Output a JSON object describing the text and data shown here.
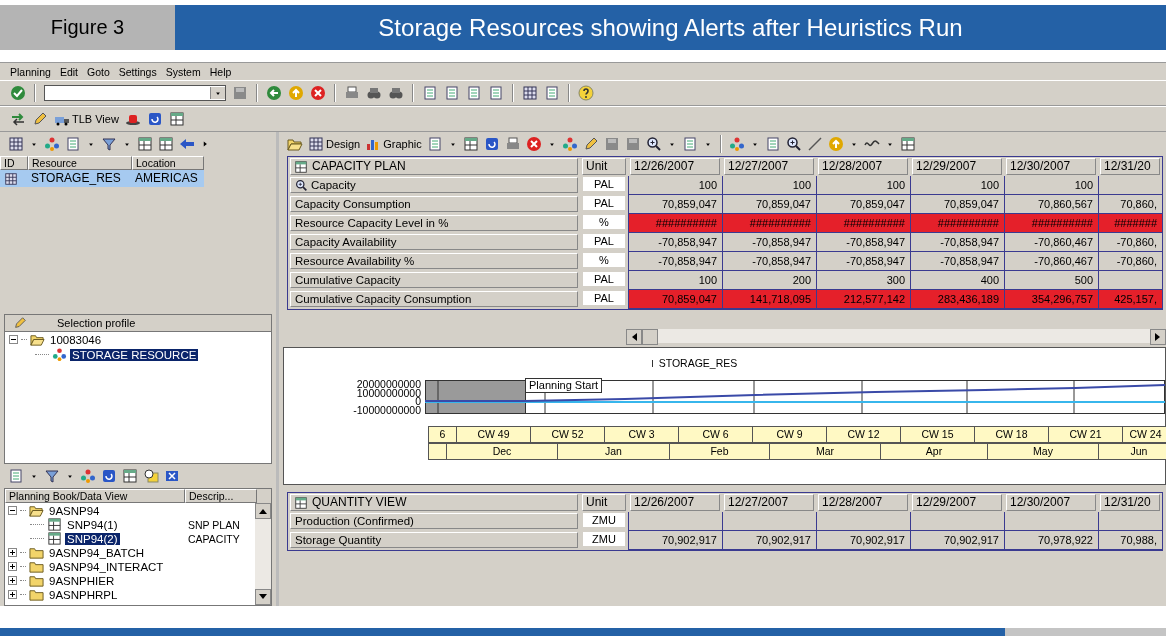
{
  "figure": {
    "label": "Figure 3",
    "title": "Storage Resources showing Alerts after Heuristics Run"
  },
  "menu": [
    "Planning",
    "Edit",
    "Goto",
    "Settings",
    "System",
    "Help"
  ],
  "tlb_view_button": "TLB View",
  "resources": {
    "id_header": "ID",
    "columns": [
      "Resource",
      "Location"
    ],
    "rows": [
      {
        "cells": [
          "STORAGE_RES",
          "AMERICAS"
        ],
        "selected": true
      }
    ]
  },
  "selection_profile": {
    "title": "Selection profile",
    "tree": [
      {
        "label": "10083046",
        "expanded": true,
        "selected": false,
        "children": [
          {
            "label": "STORAGE RESOURCE",
            "selected": true
          }
        ]
      }
    ]
  },
  "planning_books": {
    "columns": [
      "Planning Book/Data View",
      "Descrip..."
    ],
    "tree": [
      {
        "label": "9ASNP94",
        "expanded": true,
        "selected": false,
        "children": [
          {
            "label": "SNP94(1)",
            "description": "SNP PLAN",
            "selected": false
          },
          {
            "label": "SNP94(2)",
            "description": "CAPACITY",
            "selected": true
          }
        ]
      },
      {
        "label": "9ASNP94_BATCH",
        "expanded": false,
        "selected": false
      },
      {
        "label": "9ASNP94_INTERACT",
        "expanded": false,
        "selected": false
      },
      {
        "label": "9ASNPHIER",
        "expanded": false,
        "selected": false
      },
      {
        "label": "9ASNPHRPL",
        "expanded": false,
        "selected": false
      }
    ]
  },
  "grid_toolbar": {
    "buttons": [
      "Design",
      "Graphic"
    ]
  },
  "capacity_plan": {
    "title": "CAPACITY PLAN",
    "unit_header": "Unit",
    "dates": [
      "12/26/2007",
      "12/27/2007",
      "12/28/2007",
      "12/29/2007",
      "12/30/2007",
      "12/31/20"
    ],
    "rows": [
      {
        "label": "Capacity",
        "kind": "drilldown",
        "unit": "PAL",
        "alert": false,
        "values": [
          "100",
          "100",
          "100",
          "100",
          "100"
        ]
      },
      {
        "label": "Capacity Consumption",
        "kind": "plain",
        "unit": "PAL",
        "alert": false,
        "values": [
          "70,859,047",
          "70,859,047",
          "70,859,047",
          "70,859,047",
          "70,860,567",
          "70,860,"
        ]
      },
      {
        "label": "Resource Capacity Level in %",
        "kind": "plain",
        "unit": "%",
        "alert": true,
        "values": [
          "##########",
          "##########",
          "##########",
          "##########",
          "##########",
          "#######"
        ]
      },
      {
        "label": "Capacity Availability",
        "kind": "plain",
        "unit": "PAL",
        "alert": false,
        "values": [
          "-70,858,947",
          "-70,858,947",
          "-70,858,947",
          "-70,858,947",
          "-70,860,467",
          "-70,860,"
        ]
      },
      {
        "label": "Resource Availability %",
        "kind": "plain",
        "unit": "%",
        "alert": false,
        "values": [
          "-70,858,947",
          "-70,858,947",
          "-70,858,947",
          "-70,858,947",
          "-70,860,467",
          "-70,860,"
        ]
      },
      {
        "label": "Cumulative Capacity",
        "kind": "plain",
        "unit": "PAL",
        "alert": false,
        "values": [
          "100",
          "200",
          "300",
          "400",
          "500"
        ]
      },
      {
        "label": "Cumulative Capacity Consumption",
        "kind": "plain",
        "unit": "PAL",
        "alert": true,
        "values": [
          "70,859,047",
          "141,718,095",
          "212,577,142",
          "283,436,189",
          "354,296,757",
          "425,157,"
        ]
      }
    ]
  },
  "chart": {
    "title": "STORAGE_RES",
    "marker": "Planning Start",
    "y_labels": [
      "20000000000",
      "10000000000",
      "0",
      "-10000000000"
    ],
    "weeks": [
      "6",
      "CW 49",
      "CW 52",
      "CW 3",
      "CW 6",
      "CW 9",
      "CW 12",
      "CW 15",
      "CW 18",
      "CW 21",
      "CW 24"
    ],
    "months": [
      "Dec",
      "Jan",
      "Feb",
      "Mar",
      "Apr",
      "May",
      "Jun"
    ]
  },
  "quantity_view": {
    "title": "QUANTITY VIEW",
    "unit_header": "Unit",
    "dates": [
      "12/26/2007",
      "12/27/2007",
      "12/28/2007",
      "12/29/2007",
      "12/30/2007",
      "12/31/20"
    ],
    "rows": [
      {
        "label": "Production (Confirmed)",
        "unit": "ZMU",
        "alert": false
      },
      {
        "label": "Storage Quantity",
        "unit": "ZMU",
        "alert": false,
        "values": [
          "70,902,917",
          "70,902,917",
          "70,902,917",
          "70,902,917",
          "70,978,922",
          "70,988,"
        ]
      }
    ]
  }
}
